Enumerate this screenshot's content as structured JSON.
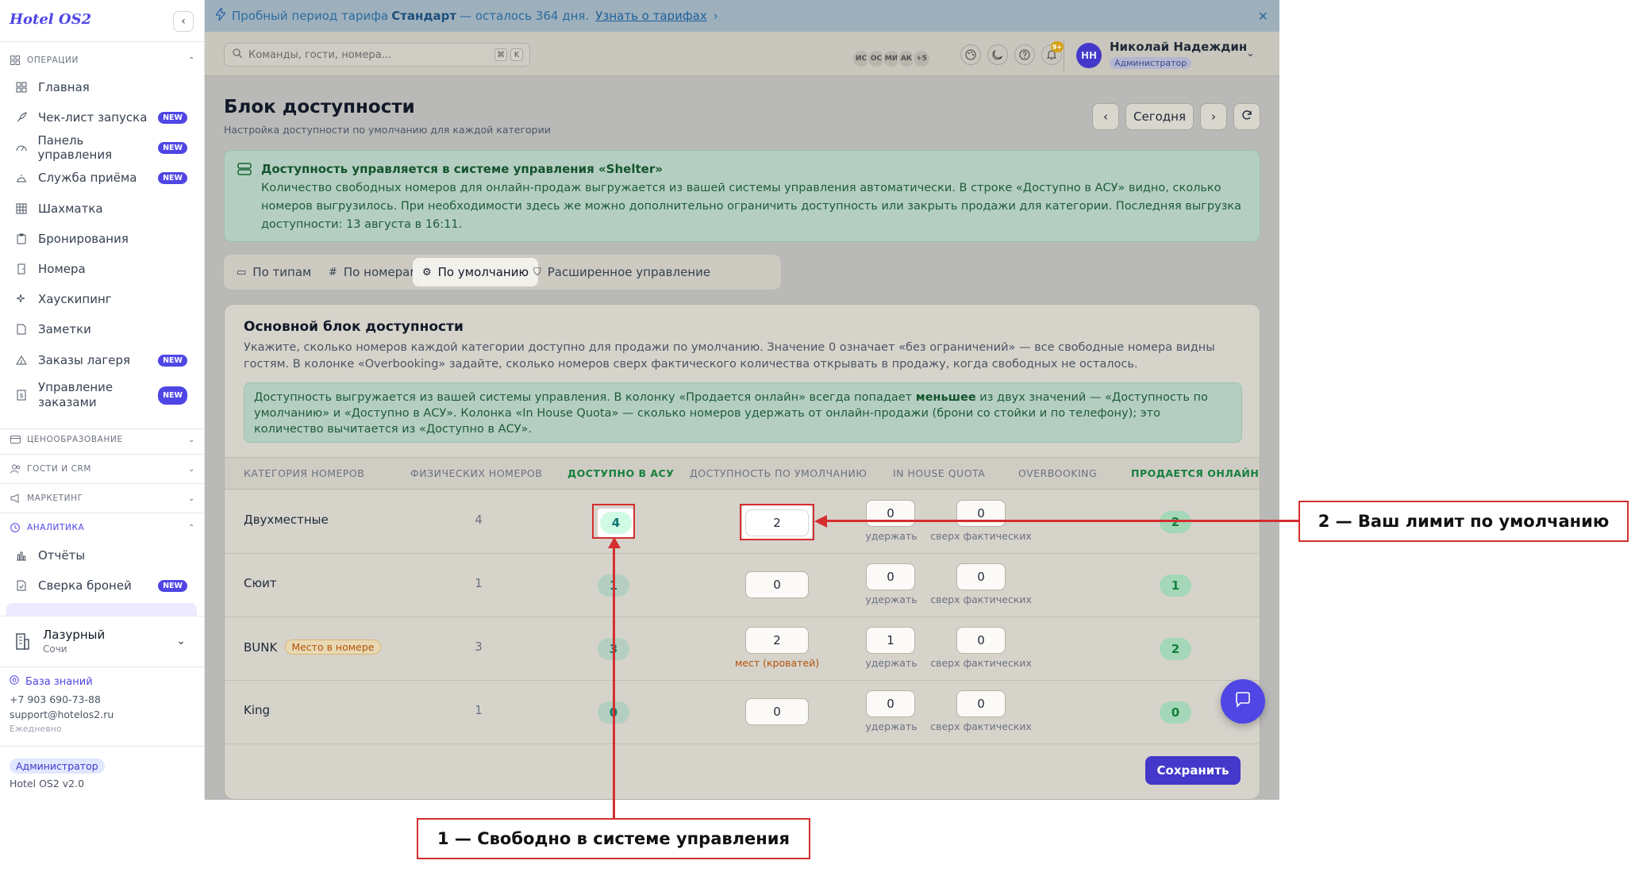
{
  "brand": "Hotel OS2",
  "sidebar": {
    "section_operations": "ОПЕРАЦИИ",
    "items": [
      {
        "label": "Главная",
        "icon": "grid-icon",
        "new": false
      },
      {
        "label": "Чек-лист запуска",
        "icon": "rocket-icon",
        "new": true
      },
      {
        "label": "Панель управления",
        "icon": "gauge-icon",
        "new": true
      },
      {
        "label": "Служба приёма",
        "icon": "bell-icon",
        "new": true
      },
      {
        "label": "Шахматка",
        "icon": "table-icon",
        "new": false
      },
      {
        "label": "Бронирования",
        "icon": "clipboard-icon",
        "new": false
      },
      {
        "label": "Номера",
        "icon": "door-icon",
        "new": false
      },
      {
        "label": "Хаускипинг",
        "icon": "sparkles-icon",
        "new": false
      },
      {
        "label": "Заметки",
        "icon": "note-icon",
        "new": false
      },
      {
        "label": "Заказы лагеря",
        "icon": "tent-icon",
        "new": true
      },
      {
        "label": "Управление заказами",
        "icon": "receipt-icon",
        "new": true
      }
    ],
    "new_badge": "NEW",
    "section_pricing": "ЦЕНООБРАЗОВАНИЕ",
    "section_guests": "ГОСТИ И CRM",
    "section_marketing": "МАРКЕТИНГ",
    "section_analytics": "АНАЛИТИКА",
    "analytics_items": [
      {
        "label": "Отчёты",
        "icon": "bar-chart-icon",
        "new": false
      },
      {
        "label": "Сверка броней",
        "icon": "doc-check-icon",
        "new": true
      }
    ],
    "hotel_name": "Лазурный",
    "hotel_city": "Сочи",
    "knowledge_base": "База знаний",
    "phone": "+7 903 690-73-88",
    "email": "support@hotelos2.ru",
    "schedule": "Ежедневно",
    "role": "Администратор",
    "version": "Hotel OS2 v2.0"
  },
  "trial": {
    "text_before": "Пробный период тарифа",
    "plan": "Стандарт",
    "text_after": "— осталось 364 дня.",
    "link": "Узнать о тарифах"
  },
  "topbar": {
    "search_placeholder": "Команды, гости, номера...",
    "kbd1": "⌘",
    "kbd2": "K",
    "avatars": [
      "ИС",
      "ОС",
      "МИ",
      "АК",
      "+5"
    ],
    "notif_count": "9+",
    "user_initials": "НН",
    "user_name": "Николай Надеждин",
    "user_role": "Администратор"
  },
  "page": {
    "title": "Блок доступности",
    "subtitle": "Настройка доступности по умолчанию для каждой категории",
    "today": "Сегодня"
  },
  "info": {
    "title": "Доступность управляется в системе управления «Shelter»",
    "text": "Количество свободных номеров для онлайн-продаж выгружается из вашей системы управления автоматически. В строке «Доступно в АСУ» видно, сколько номеров выгрузилось. При необходимости здесь же можно дополнительно ограничить доступность или закрыть продажи для категории. Последняя выгрузка доступности: 13 августа в 16:11."
  },
  "tabs": [
    "По типам",
    "По номерам",
    "По умолчанию",
    "Расширенное управление"
  ],
  "card": {
    "title": "Основной блок доступности",
    "desc": "Укажите, сколько номеров каждой категории доступно для продажи по умолчанию. Значение 0 означает «без ограничений» — все свободные номера видны гостям. В колонке «Overbooking» задайте, сколько номеров сверх фактического количества открывать в продажу, когда свободных не осталось.",
    "note_before": "Доступность выгружается из вашей системы управления. В колонку «Продается онлайн» всегда попадает ",
    "note_bold": "меньшее",
    "note_after": " из двух значений — «Доступность по умолчанию» и «Доступно в АСУ». Колонка «In House Quota» — сколько номеров удержать от онлайн-продажи (брони со стойки и по телефону); это количество вычитается из «Доступно в АСУ».",
    "headers": [
      "КАТЕГОРИЯ НОМЕРОВ",
      "ФИЗИЧЕСКИХ НОМЕРОВ",
      "ДОСТУПНО В АСУ",
      "ДОСТУПНОСТЬ ПО УМОЛЧАНИЮ",
      "IN HOUSE QUOTA",
      "OVERBOOKING",
      "ПРОДАЕТСЯ ОНЛАЙН"
    ],
    "hold_label": "удержать",
    "over_label": "сверх фактических",
    "rows": [
      {
        "name": "Двухместные",
        "tag": "",
        "physical": "4",
        "asu": "4",
        "default": "2",
        "default_note": "",
        "quota": "0",
        "overbooking": "0",
        "online": "2"
      },
      {
        "name": "Сюит",
        "tag": "",
        "physical": "1",
        "asu": "1",
        "default": "0",
        "default_note": "",
        "quota": "0",
        "overbooking": "0",
        "online": "1"
      },
      {
        "name": "BUNK",
        "tag": "Место в номере",
        "physical": "3",
        "asu": "3",
        "default": "2",
        "default_note": "мест (кроватей)",
        "quota": "1",
        "overbooking": "0",
        "online": "2"
      },
      {
        "name": "King",
        "tag": "",
        "physical": "1",
        "asu": "0",
        "default": "0",
        "default_note": "",
        "quota": "0",
        "overbooking": "0",
        "online": "0"
      }
    ],
    "save": "Сохранить"
  },
  "annotations": {
    "label1": "1 — Свободно в системе управления",
    "label2": "2 — Ваш лимит по умолчанию",
    "color": "#d32f2f"
  },
  "colors": {
    "accent": "#4f46e5",
    "success": "#15803d",
    "annotation": "#d32f2f"
  }
}
